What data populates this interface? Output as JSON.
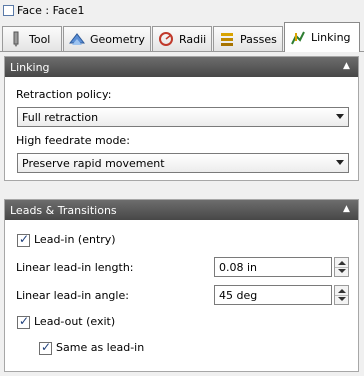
{
  "window": {
    "title": "Face : Face1"
  },
  "tabs": [
    {
      "label": "Tool"
    },
    {
      "label": "Geometry"
    },
    {
      "label": "Radii"
    },
    {
      "label": "Passes"
    },
    {
      "label": "Linking"
    }
  ],
  "linking_panel": {
    "header": "Linking",
    "retraction_label": "Retraction policy:",
    "retraction_value": "Full retraction",
    "feedrate_label": "High feedrate mode:",
    "feedrate_value": "Preserve rapid movement"
  },
  "leads_panel": {
    "header": "Leads & Transitions",
    "lead_in_label": "Lead-in (entry)",
    "lead_in_checked": true,
    "lead_in_length_label": "Linear lead-in length:",
    "lead_in_length_value": "0.08 in",
    "lead_in_angle_label": "Linear lead-in angle:",
    "lead_in_angle_value": "45 deg",
    "lead_out_label": "Lead-out (exit)",
    "lead_out_checked": true,
    "same_as_lead_in_label": "Same as lead-in",
    "same_as_lead_in_checked": true
  },
  "colors": {
    "header_bg": "#5a5a5a",
    "active_tab_bg": "#ffffff",
    "body_bg": "#f0f0f0"
  }
}
